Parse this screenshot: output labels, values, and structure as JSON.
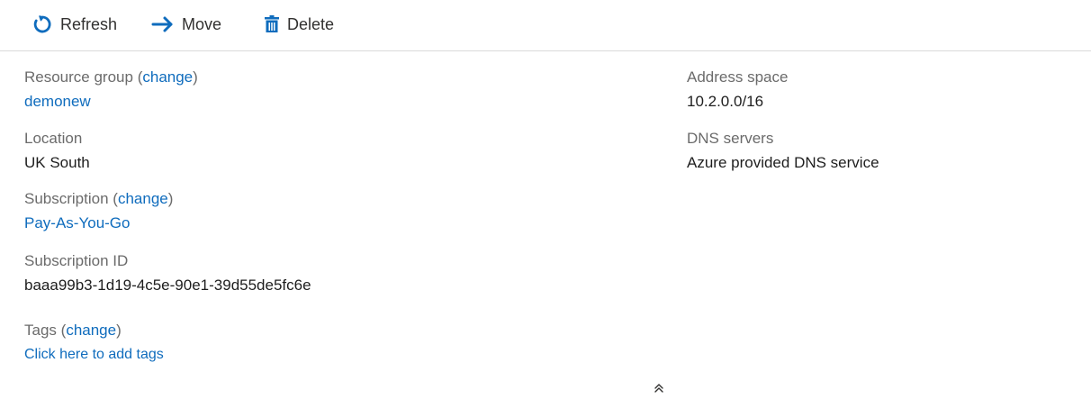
{
  "toolbar": {
    "refresh_label": "Refresh",
    "move_label": "Move",
    "delete_label": "Delete",
    "accent_color": "#0f6cbd"
  },
  "essentials": {
    "resource_group": {
      "label": "Resource group",
      "change": "change",
      "value": "demonew"
    },
    "location": {
      "label": "Location",
      "value": "UK South"
    },
    "subscription": {
      "label": "Subscription",
      "change": "change",
      "value": "Pay-As-You-Go"
    },
    "subscription_id": {
      "label": "Subscription ID",
      "value": "baaa99b3-1d19-4c5e-90e1-39d55de5fc6e"
    },
    "tags": {
      "label": "Tags",
      "change": "change",
      "value": "Click here to add tags"
    },
    "address_space": {
      "label": "Address space",
      "value": "10.2.0.0/16"
    },
    "dns_servers": {
      "label": "DNS servers",
      "value": "Azure provided DNS service"
    }
  },
  "collapse_icon": "double-chevron-up-icon"
}
